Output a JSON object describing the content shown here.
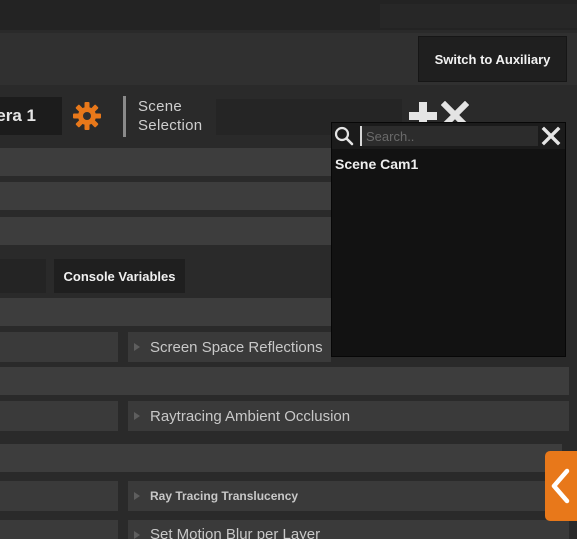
{
  "header": {
    "switch_button": "Switch to Auxiliary"
  },
  "camera": {
    "name": "era 1"
  },
  "scene": {
    "label": "Scene Selection"
  },
  "dropdown": {
    "search_placeholder": "Search..",
    "items": [
      "Scene Cam1"
    ]
  },
  "console": {
    "button_label": "Console Variables"
  },
  "properties": {
    "items": [
      "Screen Space Reflections",
      "Raytracing Ambient Occlusion",
      "Ray Tracing Translucency",
      "Set Motion Blur per Layer"
    ]
  },
  "colors": {
    "accent": "#e8781a",
    "panel": "#2a2a2a"
  },
  "icons": [
    "gear-icon",
    "plus-icon",
    "close-icon",
    "search-icon",
    "clear-icon",
    "chevron-left-icon",
    "triangle-right-icon"
  ]
}
